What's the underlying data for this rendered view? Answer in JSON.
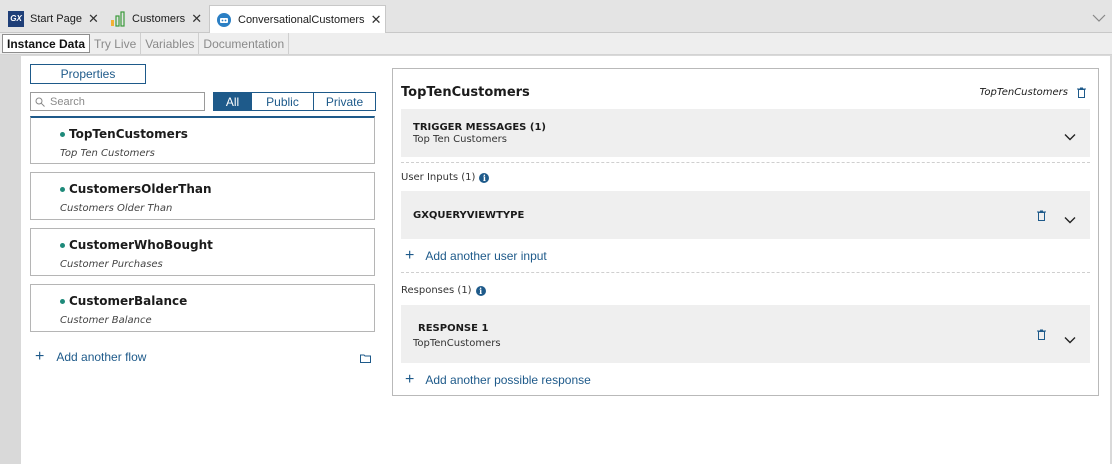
{
  "doc_tabs": [
    {
      "label": "Start Page",
      "icon": "gx-logo-icon"
    },
    {
      "label": "Customers",
      "icon": "bar-chart-icon"
    },
    {
      "label": "ConversationalCustomers",
      "icon": "conversational-icon"
    }
  ],
  "sub_tabs": [
    "Instance Data",
    "Try Live",
    "Variables",
    "Documentation"
  ],
  "left": {
    "properties_label": "Properties",
    "search_placeholder": "Search",
    "filters": [
      "All",
      "Public",
      "Private"
    ],
    "flows": [
      {
        "name": "TopTenCustomers",
        "desc": "Top Ten Customers"
      },
      {
        "name": "CustomersOlderThan",
        "desc": "Customers Older Than"
      },
      {
        "name": "CustomerWhoBought",
        "desc": "Customer Purchases"
      },
      {
        "name": "CustomerBalance",
        "desc": "Customer Balance"
      }
    ],
    "add_flow_label": "Add another flow"
  },
  "right": {
    "title": "TopTenCustomers",
    "title_right": "TopTenCustomers",
    "trigger": {
      "title": "TRIGGER MESSAGES (1)",
      "sub": "Top Ten Customers"
    },
    "user_inputs_label": "User Inputs (1)",
    "user_input": {
      "title": "GXQUERYVIEWTYPE"
    },
    "add_user_input_label": "Add another user input",
    "responses_label": "Responses (1)",
    "response": {
      "title": "RESPONSE 1",
      "sub": "TopTenCustomers"
    },
    "add_response_label": "Add another possible response"
  },
  "colors": {
    "accent": "#1e5a8a",
    "flow_dot": "#1e8a7a"
  }
}
